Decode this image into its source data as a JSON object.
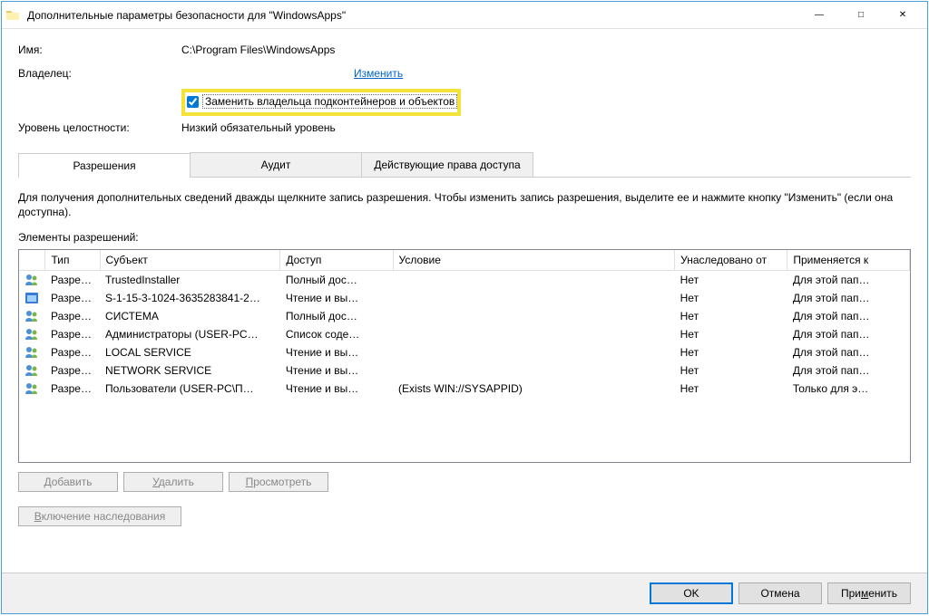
{
  "window": {
    "title": "Дополнительные параметры безопасности  для \"WindowsApps\""
  },
  "fields": {
    "name_label": "Имя:",
    "name_value": "C:\\Program Files\\WindowsApps",
    "owner_label": "Владелец:",
    "owner_change": "Изменить",
    "replace_owner_label": "Заменить владельца подконтейнеров и объектов",
    "integrity_label": "Уровень целостности:",
    "integrity_value": "Низкий обязательный уровень"
  },
  "tabs": {
    "permissions": "Разрешения",
    "audit": "Аудит",
    "effective": "Действующие права доступа"
  },
  "help_text": "Для получения дополнительных сведений дважды щелкните запись разрешения. Чтобы изменить запись разрешения, выделите ее и нажмите кнопку \"Изменить\" (если она доступна).",
  "perm_elements_label": "Элементы разрешений:",
  "columns": {
    "type": "Тип",
    "subject": "Субъект",
    "access": "Доступ",
    "condition": "Условие",
    "inherited": "Унаследовано от",
    "applies": "Применяется к"
  },
  "rows": [
    {
      "icon": "users",
      "type": "Разре…",
      "subject": "TrustedInstaller",
      "access": "Полный дос…",
      "condition": "",
      "inherited": "Нет",
      "applies": "Для этой пап…"
    },
    {
      "icon": "app",
      "type": "Разре…",
      "subject": "S-1-15-3-1024-3635283841-2…",
      "access": "Чтение и вы…",
      "condition": "",
      "inherited": "Нет",
      "applies": "Для этой пап…"
    },
    {
      "icon": "users",
      "type": "Разре…",
      "subject": "СИСТЕМА",
      "access": "Полный дос…",
      "condition": "",
      "inherited": "Нет",
      "applies": "Для этой пап…"
    },
    {
      "icon": "users",
      "type": "Разре…",
      "subject": "Администраторы (USER-PC…",
      "access": "Список соде…",
      "condition": "",
      "inherited": "Нет",
      "applies": "Для этой пап…"
    },
    {
      "icon": "users",
      "type": "Разре…",
      "subject": "LOCAL SERVICE",
      "access": "Чтение и вы…",
      "condition": "",
      "inherited": "Нет",
      "applies": "Для этой пап…"
    },
    {
      "icon": "users",
      "type": "Разре…",
      "subject": "NETWORK SERVICE",
      "access": "Чтение и вы…",
      "condition": "",
      "inherited": "Нет",
      "applies": "Для этой пап…"
    },
    {
      "icon": "users",
      "type": "Разре…",
      "subject": "Пользователи (USER-PC\\П…",
      "access": "Чтение и вы…",
      "condition": "(Exists WIN://SYSAPPID)",
      "inherited": "Нет",
      "applies": "Только для э…"
    }
  ],
  "buttons": {
    "add": "Добавить",
    "remove": "Удалить",
    "view": "Просмотреть",
    "inherit": "Включение наследования",
    "ok": "OK",
    "cancel": "Отмена",
    "apply": "Применить"
  }
}
